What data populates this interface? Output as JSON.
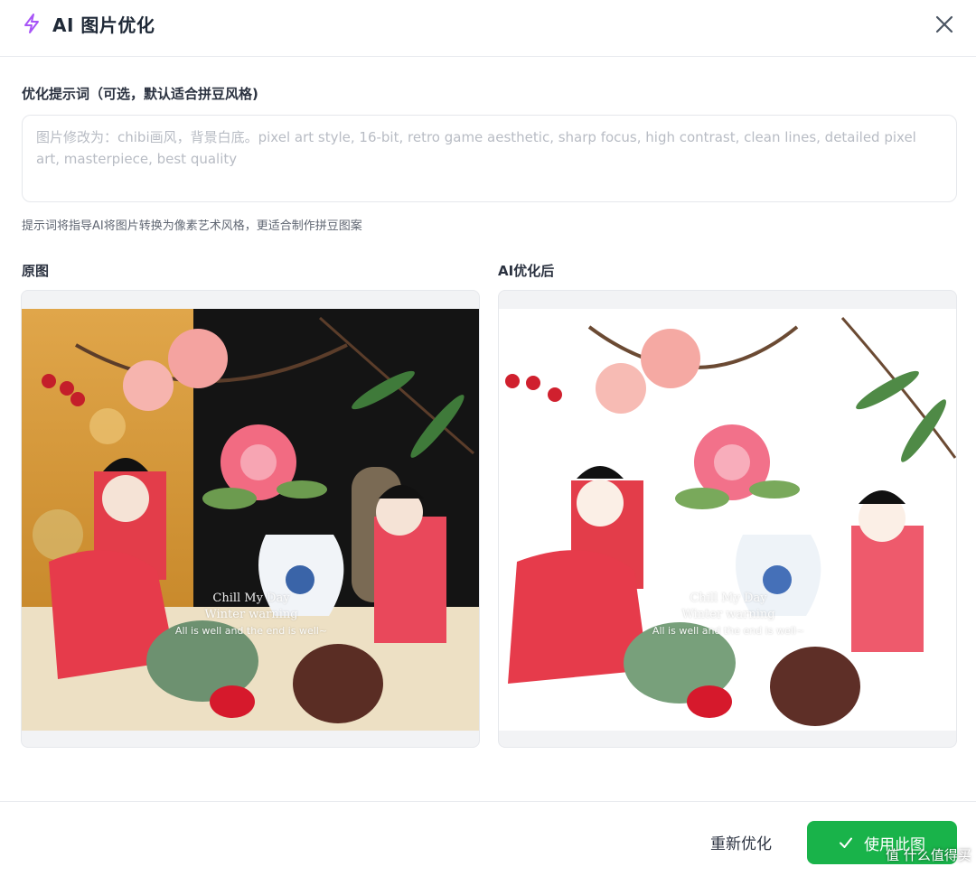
{
  "header": {
    "title": "AI 图片优化",
    "icon": "lightning-bolt-icon",
    "close_icon": "close-icon"
  },
  "prompt": {
    "label": "优化提示词（可选，默认适合拼豆风格)",
    "value": "",
    "placeholder": "图片修改为：chibi画风，背景白底。pixel art style, 16-bit, retro game aesthetic, sharp focus, high contrast, clean lines, detailed pixel art, masterpiece, best quality",
    "hint": "提示词将指导AI将图片转换为像素艺术风格，更适合制作拼豆图案"
  },
  "original": {
    "label": "原图",
    "watermark": [
      "Chill My Day",
      "Winter warning",
      "All is well and the end is well~"
    ]
  },
  "optimized": {
    "label": "AI优化后",
    "watermark": [
      "Chill My Day",
      "Winter warning",
      "All is well and the end is well~"
    ]
  },
  "footer": {
    "retry_label": "重新优化",
    "use_label": "使用此图",
    "site_watermark": "值 什么值得买"
  },
  "colors": {
    "accent_purple": "#a855f7",
    "primary_green": "#19b34a"
  }
}
